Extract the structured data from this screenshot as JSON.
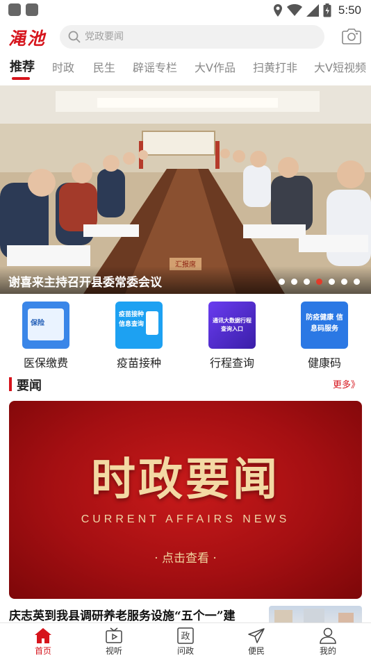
{
  "status_bar": {
    "time": "5:50",
    "icons": [
      "location-icon",
      "wifi-icon",
      "signal-icon",
      "battery-icon"
    ]
  },
  "header": {
    "logo_text": "渑池",
    "search_placeholder": "党政要闻",
    "camera_icon": "camera-icon"
  },
  "tabs": [
    {
      "label": "推荐",
      "active": true
    },
    {
      "label": "时政",
      "active": false
    },
    {
      "label": "民生",
      "active": false
    },
    {
      "label": "辟谣专栏",
      "active": false
    },
    {
      "label": "大V作品",
      "active": false
    },
    {
      "label": "扫黄打非",
      "active": false
    },
    {
      "label": "大V短视频",
      "active": false
    }
  ],
  "banner": {
    "title": "谢喜来主持召开县委常委会议",
    "slide_count": 7,
    "active_slide": 4,
    "room_sign": "汇报席"
  },
  "services": [
    {
      "label": "医保缴费",
      "icon_text": "保险",
      "color": "#3a86e8"
    },
    {
      "label": "疫苗接种",
      "icon_text": "疫苗接种 信息查询",
      "color": "#1da1f2"
    },
    {
      "label": "行程查询",
      "icon_text": "通讯大数据行程 查询入口",
      "color": "#5a2fd6"
    },
    {
      "label": "健康码",
      "icon_text": "防疫健康 信息码服务",
      "color": "#2b78e4"
    }
  ],
  "section": {
    "title": "要闻",
    "more_label": "更多》"
  },
  "feature": {
    "title": "时政要闻",
    "subtitle": "CURRENT AFFAIRS NEWS",
    "cta": "· 点击查看 ·"
  },
  "article": {
    "title": "庆志英到我县调研养老服务设施“五个一”建"
  },
  "bottom_nav": [
    {
      "label": "首页",
      "icon": "home-icon",
      "active": true
    },
    {
      "label": "视听",
      "icon": "tv-icon",
      "active": false
    },
    {
      "label": "问政",
      "icon": "politics-icon",
      "active": false
    },
    {
      "label": "便民",
      "icon": "send-icon",
      "active": false
    },
    {
      "label": "我的",
      "icon": "user-icon",
      "active": false
    }
  ],
  "colors": {
    "brand_red": "#d6141c",
    "active_dot": "#e23b2a"
  }
}
